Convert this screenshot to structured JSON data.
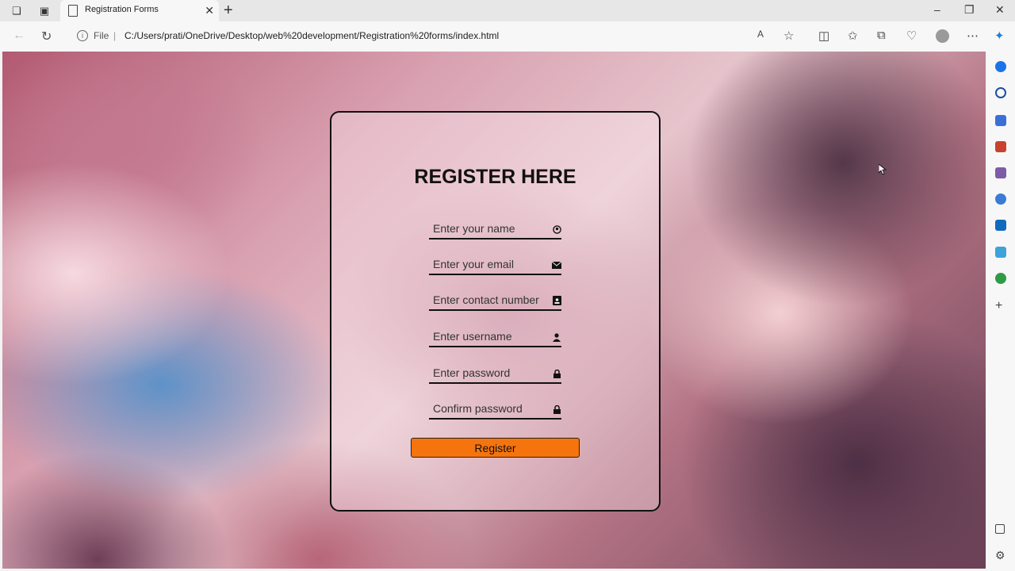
{
  "browser": {
    "tab_title": "Registration Forms",
    "address_scheme": "File",
    "address_url": "C:/Users/prati/OneDrive/Desktop/web%20development/Registration%20forms/index.html"
  },
  "form": {
    "title": "REGISTER HERE",
    "fields": [
      {
        "placeholder": "Enter your name",
        "icon": "user-circle-icon"
      },
      {
        "placeholder": "Enter your email",
        "icon": "envelope-icon"
      },
      {
        "placeholder": "Enter contact number",
        "icon": "contact-card-icon"
      },
      {
        "placeholder": "Enter username",
        "icon": "person-icon"
      },
      {
        "placeholder": "Enter password",
        "icon": "lock-icon"
      },
      {
        "placeholder": "Confirm password",
        "icon": "lock-icon"
      }
    ],
    "button_label": "Register",
    "button_color": "#f5740d"
  }
}
